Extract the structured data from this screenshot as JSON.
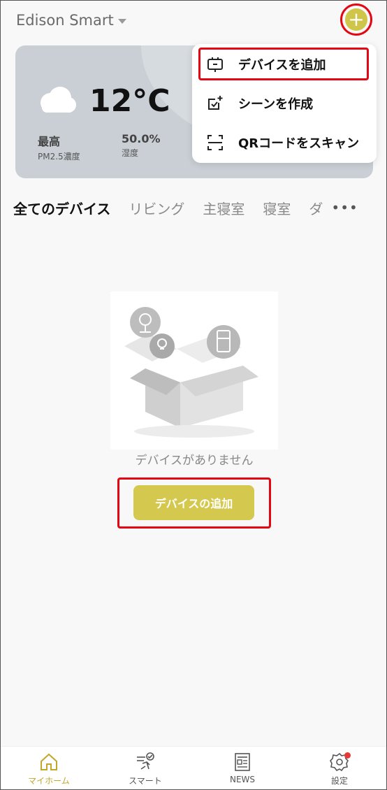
{
  "header": {
    "home_name": "Edison Smart",
    "add_icon": "plus-circle-icon"
  },
  "weather": {
    "condition_icon": "cloud-icon",
    "temperature": "12°C",
    "stat1_value": "最高",
    "stat1_label": "PM2.5濃度",
    "stat2_value": "50.0%",
    "stat2_label": "湿度"
  },
  "menu": {
    "items": [
      {
        "label": "デバイスを追加",
        "icon": "add-device-icon"
      },
      {
        "label": "シーンを作成",
        "icon": "create-scene-icon"
      },
      {
        "label": "QRコードをスキャン",
        "icon": "qr-scan-icon"
      }
    ]
  },
  "tabs": {
    "items": [
      "全てのデバイス",
      "リビング",
      "主寝室",
      "寝室",
      "ダ"
    ],
    "active_index": 0,
    "more": "•••"
  },
  "empty_state": {
    "message": "デバイスがありません",
    "button_label": "デバイスの追加"
  },
  "bottom_nav": {
    "items": [
      {
        "label": "マイホーム",
        "icon": "home-icon"
      },
      {
        "label": "スマート",
        "icon": "smart-icon"
      },
      {
        "label": "NEWS",
        "icon": "news-icon"
      },
      {
        "label": "設定",
        "icon": "settings-icon"
      }
    ],
    "active_index": 0
  },
  "colors": {
    "accent": "#cfc549",
    "highlight": "#e30613",
    "weather_card": "#c9cfd5"
  }
}
